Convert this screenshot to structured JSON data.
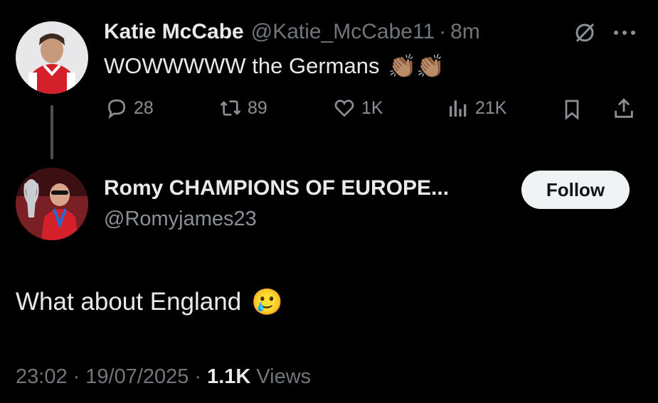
{
  "tweet": {
    "author_name": "Katie McCabe",
    "handle": "@Katie_McCabe11",
    "time": "8m",
    "text": "WOWWWWW the Germans",
    "emoji": "👏🏽👏🏽",
    "replies": "28",
    "reposts": "89",
    "likes": "1K",
    "views": "21K"
  },
  "reply": {
    "author_name": "Romy CHAMPIONS OF EUROPE...",
    "handle": "@Romyjames23",
    "follow_label": "Follow",
    "text": "What about England",
    "emoji": "🥲",
    "time": "23:02",
    "date": "19/07/2025",
    "views_count": "1.1K",
    "views_label": "Views"
  },
  "icons": {
    "more": "more-icon",
    "grok": "grok-icon",
    "reply": "reply-icon",
    "repost": "repost-icon",
    "like": "heart-icon",
    "views": "analytics-icon",
    "bookmark": "bookmark-icon",
    "share": "share-icon"
  },
  "colors": {
    "background": "#000000",
    "text": "#e7e9ea",
    "secondary": "#71767b",
    "follow_bg": "#eff3f4"
  }
}
